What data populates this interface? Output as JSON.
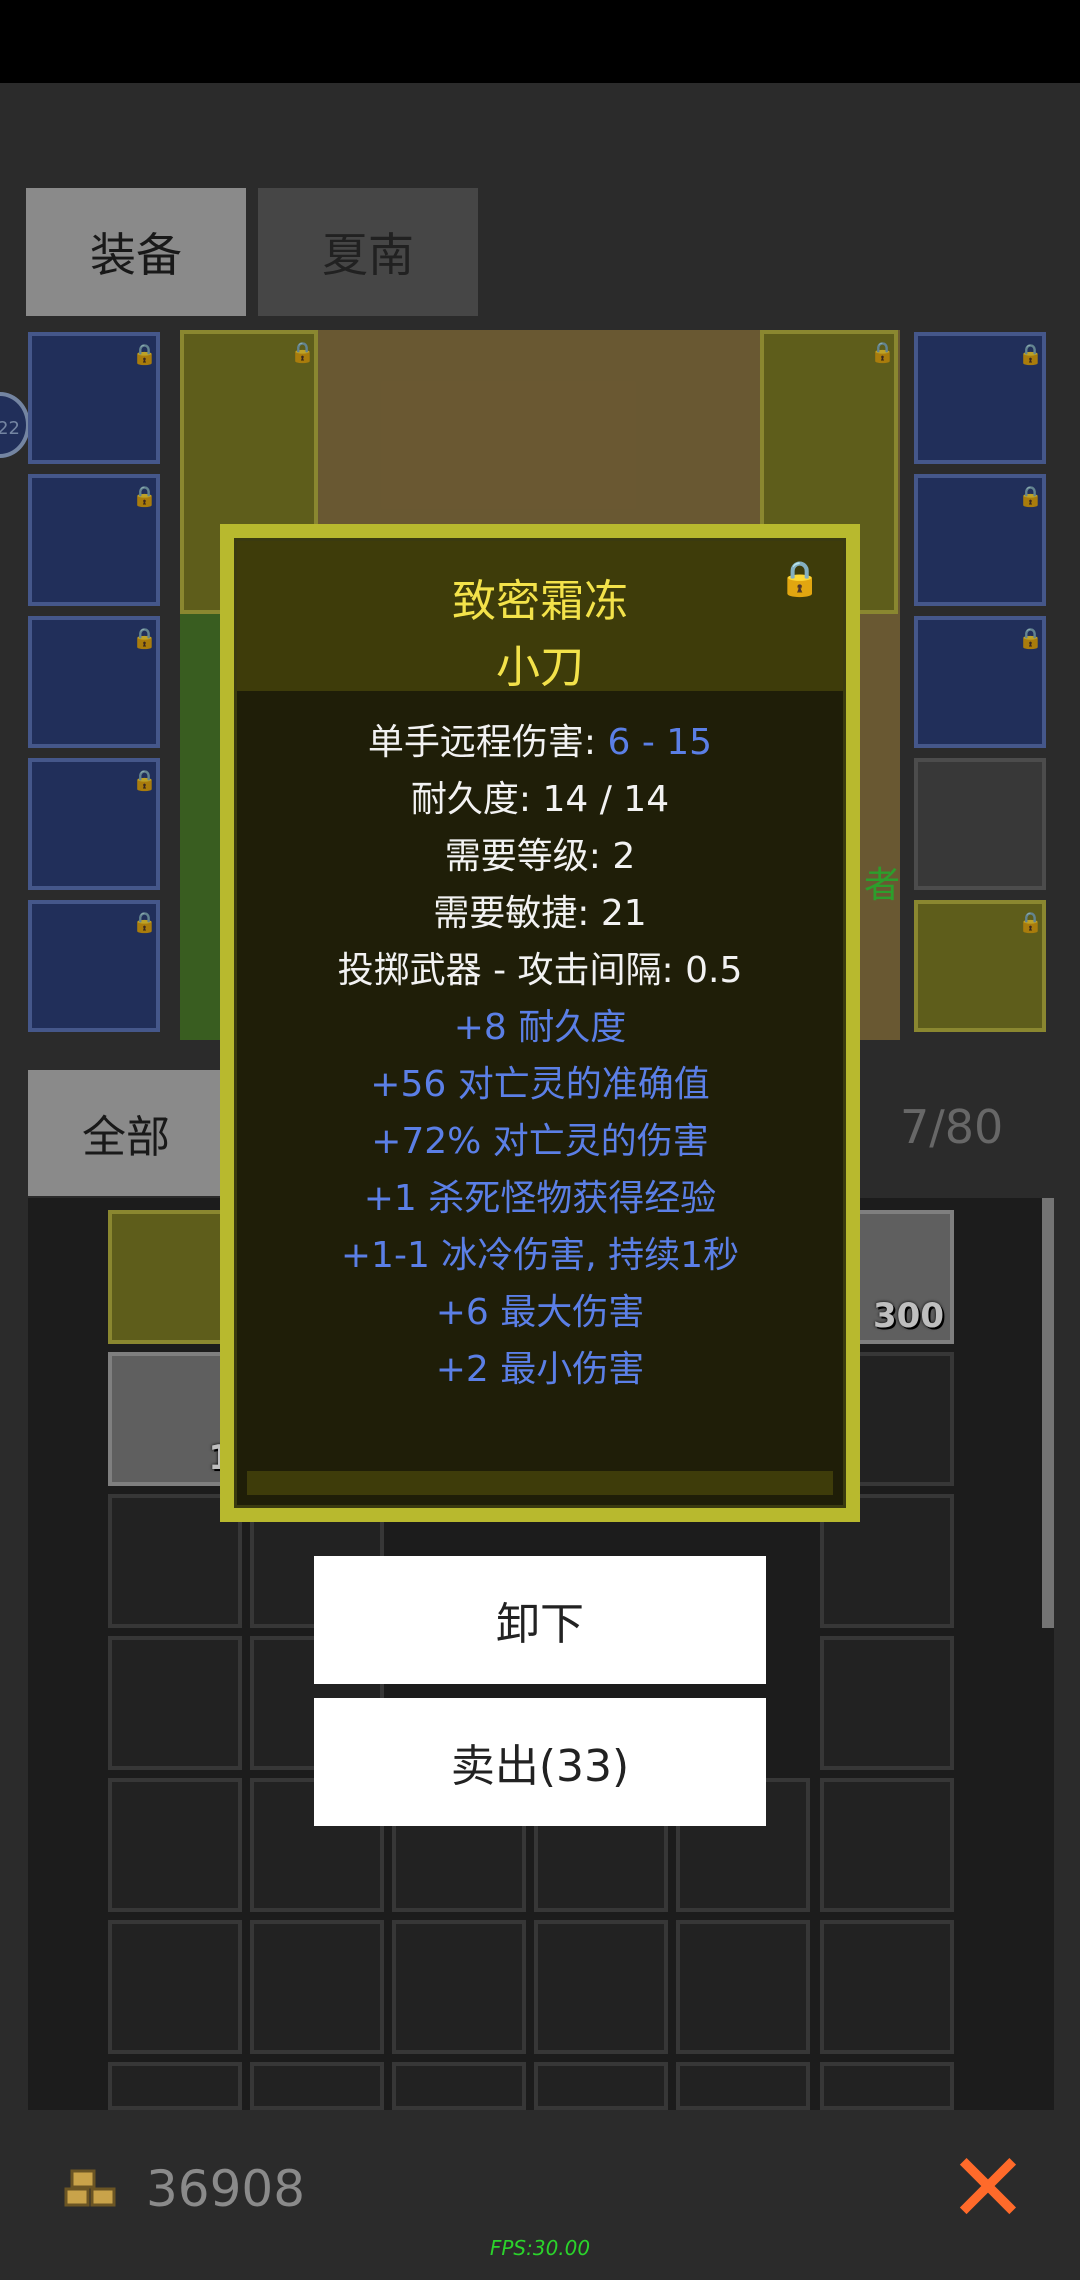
{
  "tabs": [
    {
      "label": "装备"
    },
    {
      "label": "夏南"
    }
  ],
  "bubble": {
    "text": "22"
  },
  "scene": {
    "name_fragment": "者"
  },
  "filter": {
    "label": "全部"
  },
  "inventory": {
    "count": "7/80",
    "item_qty_gold": "300",
    "item_qty_leather": "1"
  },
  "tooltip": {
    "name": "致密霜冻",
    "type": "小刀",
    "lines": [
      {
        "text": "单手远程伤害: ",
        "value": "6 - 15"
      },
      {
        "text": "耐久度: 14 / 14"
      },
      {
        "text": "需要等级: 2"
      },
      {
        "text": "需要敏捷: 21"
      },
      {
        "text": "投掷武器 - 攻击间隔: 0.5"
      }
    ],
    "mods": [
      "+8 耐久度",
      "+56 对亡灵的准确值",
      "+72% 对亡灵的伤害",
      "+1 杀死怪物获得经验",
      "+1-1 冰冷伤害, 持续1秒",
      "+6 最大伤害",
      "+2 最小伤害"
    ],
    "lock_icon": "lock-icon"
  },
  "actions": {
    "unequip": "卸下",
    "sell": "卖出(33)"
  },
  "footer": {
    "gold": "36908",
    "fps": "FPS:30.00"
  },
  "colors": {
    "accent_yellow": "#f3e24a",
    "mod_blue": "#5b7fe6",
    "slot_blue": "#2c3f78",
    "close_orange": "#ff6a2a"
  }
}
